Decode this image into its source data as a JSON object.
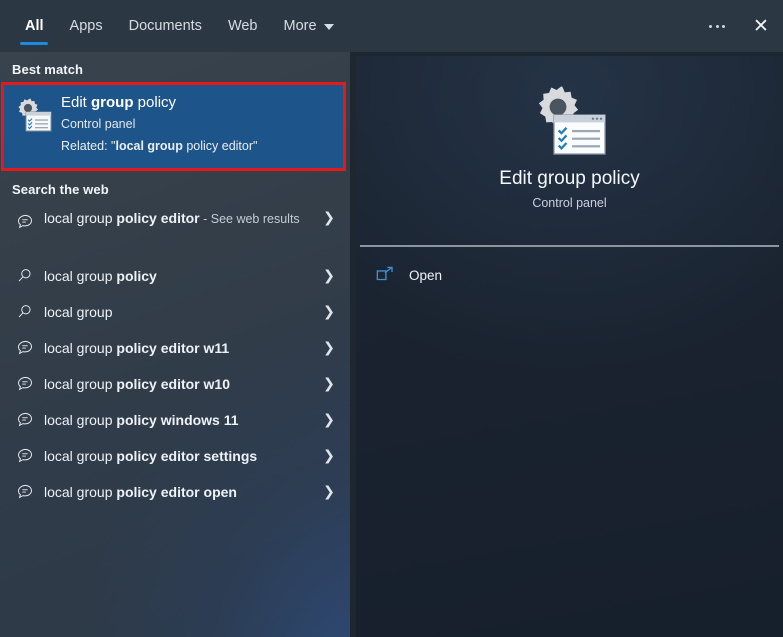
{
  "header": {
    "tabs": [
      {
        "label": "All",
        "active": true
      },
      {
        "label": "Apps",
        "active": false
      },
      {
        "label": "Documents",
        "active": false
      },
      {
        "label": "Web",
        "active": false
      },
      {
        "label": "More",
        "active": false,
        "caret": true
      }
    ],
    "more_icon": "chevron-down-icon",
    "overflow_icon": "ellipsis-icon",
    "close_icon": "close-icon",
    "accent_color": "#1b8ae0"
  },
  "left": {
    "best_match_heading": "Best match",
    "search_web_heading": "Search the web",
    "highlight_color": "#e8171a",
    "selection_color": "#1d5489",
    "best_match": {
      "icon": "group-policy-icon",
      "title_prefix": "Edit ",
      "title_bold": "group",
      "title_suffix": " policy",
      "subtitle": "Control panel",
      "related_prefix": "Related: \"",
      "related_bold": "local group",
      "related_suffix": " policy editor\""
    },
    "web_results": [
      {
        "icon": "search-suggestion-icon",
        "normal": "local group ",
        "bold": "policy editor",
        "dim": " - See web results",
        "chevron": "chevron-right-icon",
        "two_line": true
      },
      {
        "icon": "magnifier-icon",
        "normal": "local group ",
        "bold": "policy",
        "dim": "",
        "chevron": "chevron-right-icon",
        "two_line": false
      },
      {
        "icon": "magnifier-icon",
        "normal": "local group",
        "bold": "",
        "dim": "",
        "chevron": "chevron-right-icon",
        "two_line": false
      },
      {
        "icon": "search-suggestion-icon",
        "normal": "local group ",
        "bold": "policy editor w11",
        "dim": "",
        "chevron": "chevron-right-icon",
        "two_line": false
      },
      {
        "icon": "search-suggestion-icon",
        "normal": "local group ",
        "bold": "policy editor w10",
        "dim": "",
        "chevron": "chevron-right-icon",
        "two_line": false
      },
      {
        "icon": "search-suggestion-icon",
        "normal": "local group ",
        "bold": "policy windows 11",
        "dim": "",
        "chevron": "chevron-right-icon",
        "two_line": false
      },
      {
        "icon": "search-suggestion-icon",
        "normal": "local group ",
        "bold": "policy editor settings",
        "dim": "",
        "chevron": "chevron-right-icon",
        "two_line": false
      },
      {
        "icon": "search-suggestion-icon",
        "normal": "local group ",
        "bold": "policy editor open",
        "dim": "",
        "chevron": "chevron-right-icon",
        "two_line": false
      }
    ]
  },
  "preview": {
    "icon": "group-policy-icon",
    "title": "Edit group policy",
    "subtitle": "Control panel",
    "open_icon": "open-external-icon",
    "open_label": "Open"
  }
}
